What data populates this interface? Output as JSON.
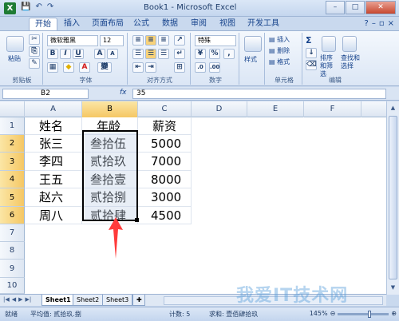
{
  "window": {
    "title": "Book1 - Microsoft Excel",
    "app_icon": "X",
    "minimize": "–",
    "maximize": "□",
    "close": "✕"
  },
  "qat": {
    "save": "💾",
    "undo": "↶",
    "redo": "↷"
  },
  "tabs": [
    "开始",
    "插入",
    "页面布局",
    "公式",
    "数据",
    "审阅",
    "视图",
    "开发工具"
  ],
  "ribbon": {
    "clipboard": {
      "paste": "粘贴",
      "label": "剪贴板"
    },
    "font": {
      "name": "微软雅黑",
      "size": "12",
      "bold": "B",
      "italic": "I",
      "underline": "U",
      "grow": "A",
      "shrink": "A",
      "color_glyph": "A",
      "phonetic": "變",
      "label": "字体"
    },
    "alignment": {
      "label": "对齐方式"
    },
    "number": {
      "format": "特殊",
      "percent": "%",
      "comma": ",",
      "currency": "¥",
      "label": "数字"
    },
    "styles": {
      "styles": "样式"
    },
    "cells": {
      "insert": "插入",
      "delete": "删除",
      "format": "格式",
      "label": "单元格"
    },
    "editing": {
      "sum": "Σ",
      "sort_filter": "排序和筛选",
      "find_select": "查找和选择",
      "label": "编辑"
    }
  },
  "formula_bar": {
    "name_box": "B2",
    "fx": "fx",
    "value": "35"
  },
  "columns": [
    "A",
    "B",
    "C",
    "D",
    "E",
    "F"
  ],
  "rows": [
    "1",
    "2",
    "3",
    "4",
    "5",
    "6",
    "7",
    "8",
    "9",
    "10"
  ],
  "table": {
    "headers": [
      "姓名",
      "年龄",
      "薪资"
    ],
    "rows": [
      [
        "张三",
        "叁拾伍",
        "5000"
      ],
      [
        "李四",
        "贰拾玖",
        "7000"
      ],
      [
        "王五",
        "叁拾壹",
        "8000"
      ],
      [
        "赵六",
        "贰拾捌",
        "3000"
      ],
      [
        "周八",
        "贰拾肆",
        "4500"
      ]
    ]
  },
  "sheets": [
    "Sheet1",
    "Sheet2",
    "Sheet3"
  ],
  "status": {
    "mode": "就绪",
    "average": "平均值: 贰拾玖.捌",
    "count": "计数: 5",
    "sum": "求和: 壹佰肆拾玖",
    "zoom": "145%"
  },
  "watermark": "我爱IT技术网",
  "colors": {
    "accent": "#15428b",
    "selection": "#f5c764",
    "arrow": "#ff3b3b"
  }
}
